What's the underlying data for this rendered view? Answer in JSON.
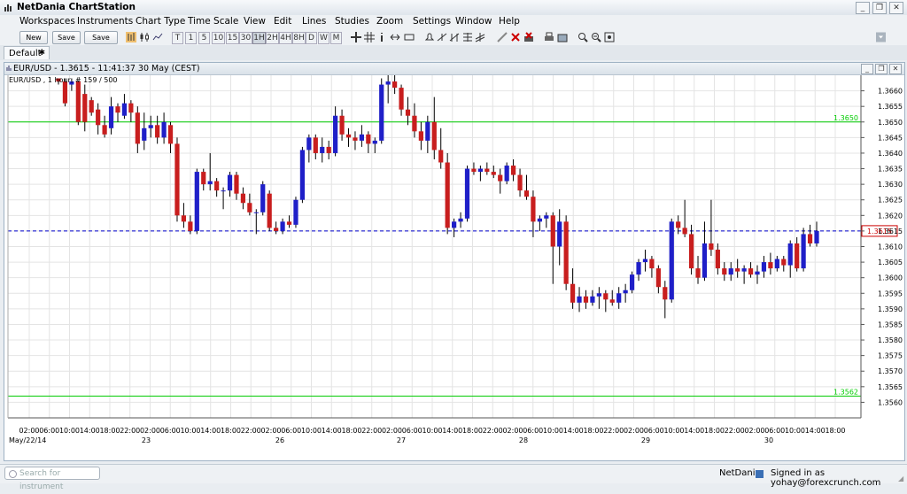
{
  "app": {
    "title": "NetDania ChartStation",
    "win_buttons": [
      "_",
      "❐",
      "✕"
    ]
  },
  "menu": [
    "Workspaces",
    "Instruments",
    "Chart Type",
    "Time Scale",
    "View",
    "Edit",
    "Lines",
    "Studies",
    "Zoom",
    "Settings",
    "Window",
    "Help"
  ],
  "toolbar": {
    "buttons": [
      "New",
      "Save",
      "Save as.."
    ],
    "timescales": [
      "T",
      "1",
      "5",
      "10",
      "15",
      "30",
      "1H",
      "2H",
      "4H",
      "8H",
      "D",
      "W",
      "M"
    ]
  },
  "tab": {
    "label": "Default",
    "pin": "✱"
  },
  "chart_window": {
    "title": "EUR/USD - 1.3615 - 11:41:37  30 May (CEST)",
    "win_buttons": [
      "_",
      "❐",
      "✕"
    ]
  },
  "chart_data": {
    "type": "candlestick",
    "instrument_label": "EUR/USD , 1 hour, # 159 / 500",
    "ylim": [
      1.3555,
      1.3665
    ],
    "y_ticks": [
      1.356,
      1.3565,
      1.357,
      1.3575,
      1.358,
      1.3585,
      1.359,
      1.3595,
      1.36,
      1.3605,
      1.361,
      1.3615,
      1.362,
      1.3625,
      1.363,
      1.3635,
      1.364,
      1.3645,
      1.365,
      1.3655,
      1.366
    ],
    "y_tick_labels": [
      "1.3560",
      "1.3565",
      "1.3570",
      "1.3575",
      "1.3580",
      "1.3585",
      "1.3590",
      "1.3595",
      "1.3600",
      "1.3605",
      "1.3610",
      "1.3615",
      "1.3620",
      "1.3625",
      "1.3630",
      "1.3635",
      "1.3640",
      "1.3645",
      "1.3650",
      "1.3655",
      "1.3660"
    ],
    "x_tick_labels": [
      "02:00",
      "06:00",
      "10:00",
      "14:00",
      "18:00",
      "22:00",
      "02:00",
      "06:00",
      "10:00",
      "14:00",
      "18:00",
      "22:00",
      "02:00",
      "06:00",
      "10:00",
      "14:00",
      "18:00",
      "22:00",
      "02:00",
      "06:00",
      "10:00",
      "14:00",
      "18:00",
      "22:00",
      "02:00",
      "06:00",
      "10:00",
      "14:00",
      "18:00",
      "22:00",
      "02:00",
      "06:00",
      "10:00",
      "14:00",
      "18:00",
      "22:00",
      "02:00",
      "06:00",
      "10:00",
      "14:00",
      "18:00"
    ],
    "date_labels": [
      "May/22/14",
      "23",
      "26",
      "27",
      "28",
      "29",
      "30"
    ],
    "horizontal_lines": [
      {
        "label": "1.3650",
        "value": 1.365,
        "color": "#00cc00"
      },
      {
        "label": "1.3562",
        "value": 1.3562,
        "color": "#00cc00"
      }
    ],
    "current_price": {
      "label": "1.3615",
      "value": 1.3615,
      "color": "#0000cc"
    },
    "colors": {
      "up": "#1f1fc8",
      "down": "#c81e1e",
      "grid": "#e4e4e4"
    },
    "candles": [
      [
        1.3664,
        1.3664,
        1.3662,
        1.3663
      ],
      [
        1.3663,
        1.3664,
        1.3655,
        1.3656
      ],
      [
        1.3662,
        1.3664,
        1.366,
        1.3663
      ],
      [
        1.3663,
        1.3663,
        1.3649,
        1.365
      ],
      [
        1.3659,
        1.3662,
        1.3647,
        1.365
      ],
      [
        1.3657,
        1.3658,
        1.3652,
        1.3653
      ],
      [
        1.3654,
        1.3656,
        1.3646,
        1.3649
      ],
      [
        1.3649,
        1.3652,
        1.3645,
        1.3646
      ],
      [
        1.3648,
        1.3658,
        1.3646,
        1.3655
      ],
      [
        1.3655,
        1.3656,
        1.365,
        1.3653
      ],
      [
        1.3652,
        1.3659,
        1.3651,
        1.3656
      ],
      [
        1.3656,
        1.3657,
        1.365,
        1.3653
      ],
      [
        1.3653,
        1.3655,
        1.364,
        1.3643
      ],
      [
        1.3644,
        1.3653,
        1.3641,
        1.3648
      ],
      [
        1.3648,
        1.3652,
        1.3645,
        1.3649
      ],
      [
        1.3649,
        1.3652,
        1.3643,
        1.3645
      ],
      [
        1.3645,
        1.3653,
        1.3643,
        1.365
      ],
      [
        1.3649,
        1.365,
        1.364,
        1.3643
      ],
      [
        1.3643,
        1.3645,
        1.3618,
        1.362
      ],
      [
        1.362,
        1.3624,
        1.3616,
        1.3618
      ],
      [
        1.3618,
        1.362,
        1.3614,
        1.3615
      ],
      [
        1.3615,
        1.3635,
        1.3614,
        1.3634
      ],
      [
        1.3634,
        1.3635,
        1.3628,
        1.363
      ],
      [
        1.363,
        1.364,
        1.3628,
        1.3631
      ],
      [
        1.3631,
        1.3632,
        1.3626,
        1.3628
      ],
      [
        1.3628,
        1.3629,
        1.3622,
        1.3628
      ],
      [
        1.3628,
        1.3634,
        1.3626,
        1.3633
      ],
      [
        1.3633,
        1.3634,
        1.3625,
        1.3627
      ],
      [
        1.3627,
        1.3629,
        1.3622,
        1.3624
      ],
      [
        1.3624,
        1.3627,
        1.362,
        1.3621
      ],
      [
        1.3621,
        1.3622,
        1.3614,
        1.3621
      ],
      [
        1.3621,
        1.3631,
        1.362,
        1.363
      ],
      [
        1.3627,
        1.3628,
        1.3615,
        1.3616
      ],
      [
        1.3616,
        1.3618,
        1.3614,
        1.3615
      ],
      [
        1.3615,
        1.3619,
        1.3614,
        1.3618
      ],
      [
        1.3618,
        1.362,
        1.3616,
        1.3617
      ],
      [
        1.3617,
        1.3626,
        1.3616,
        1.3625
      ],
      [
        1.3625,
        1.3642,
        1.3624,
        1.3641
      ],
      [
        1.3641,
        1.3646,
        1.3637,
        1.3645
      ],
      [
        1.3645,
        1.3646,
        1.3638,
        1.364
      ],
      [
        1.364,
        1.3645,
        1.3637,
        1.3642
      ],
      [
        1.3642,
        1.3644,
        1.3638,
        1.364
      ],
      [
        1.364,
        1.3655,
        1.3639,
        1.3652
      ],
      [
        1.3652,
        1.3654,
        1.3644,
        1.3646
      ],
      [
        1.3646,
        1.3648,
        1.3642,
        1.3645
      ],
      [
        1.3645,
        1.3647,
        1.3641,
        1.3644
      ],
      [
        1.3644,
        1.3649,
        1.3642,
        1.3646
      ],
      [
        1.3646,
        1.3647,
        1.364,
        1.3643
      ],
      [
        1.3643,
        1.3645,
        1.364,
        1.3644
      ],
      [
        1.3644,
        1.3664,
        1.3643,
        1.3662
      ],
      [
        1.3662,
        1.3665,
        1.3656,
        1.3663
      ],
      [
        1.3663,
        1.3665,
        1.3659,
        1.3661
      ],
      [
        1.3661,
        1.3662,
        1.3652,
        1.3654
      ],
      [
        1.3654,
        1.3658,
        1.3649,
        1.3652
      ],
      [
        1.3652,
        1.3656,
        1.3645,
        1.3647
      ],
      [
        1.3647,
        1.365,
        1.3641,
        1.3644
      ],
      [
        1.3644,
        1.3652,
        1.364,
        1.365
      ],
      [
        1.365,
        1.3658,
        1.3638,
        1.3641
      ],
      [
        1.3641,
        1.3648,
        1.3635,
        1.3637
      ],
      [
        1.3637,
        1.364,
        1.3614,
        1.3616
      ],
      [
        1.3616,
        1.3619,
        1.3613,
        1.3618
      ],
      [
        1.3618,
        1.3621,
        1.3616,
        1.3619
      ],
      [
        1.3619,
        1.3636,
        1.3618,
        1.3635
      ],
      [
        1.3635,
        1.3637,
        1.3633,
        1.3634
      ],
      [
        1.3634,
        1.3636,
        1.3631,
        1.3635
      ],
      [
        1.3635,
        1.3637,
        1.3633,
        1.3634
      ],
      [
        1.3634,
        1.3636,
        1.3632,
        1.3633
      ],
      [
        1.3633,
        1.3635,
        1.3627,
        1.3631
      ],
      [
        1.3631,
        1.3637,
        1.363,
        1.3636
      ],
      [
        1.3636,
        1.3638,
        1.3631,
        1.3633
      ],
      [
        1.3633,
        1.3635,
        1.3626,
        1.3628
      ],
      [
        1.3628,
        1.3633,
        1.3625,
        1.3626
      ],
      [
        1.3626,
        1.3628,
        1.3613,
        1.3618
      ],
      [
        1.3618,
        1.362,
        1.3615,
        1.3619
      ],
      [
        1.3619,
        1.3621,
        1.3616,
        1.362
      ],
      [
        1.362,
        1.3621,
        1.3598,
        1.361
      ],
      [
        1.361,
        1.3622,
        1.3604,
        1.3618
      ],
      [
        1.3618,
        1.362,
        1.3596,
        1.3598
      ],
      [
        1.3598,
        1.3603,
        1.359,
        1.3592
      ],
      [
        1.3592,
        1.3597,
        1.3589,
        1.3594
      ],
      [
        1.3594,
        1.3596,
        1.359,
        1.3592
      ],
      [
        1.3592,
        1.3596,
        1.3591,
        1.3594
      ],
      [
        1.3594,
        1.3597,
        1.359,
        1.3595
      ],
      [
        1.3595,
        1.3596,
        1.3589,
        1.3593
      ],
      [
        1.3593,
        1.3596,
        1.3591,
        1.3592
      ],
      [
        1.3592,
        1.3597,
        1.359,
        1.3595
      ],
      [
        1.3595,
        1.3598,
        1.3592,
        1.3596
      ],
      [
        1.3596,
        1.3602,
        1.3595,
        1.3601
      ],
      [
        1.3601,
        1.3606,
        1.3599,
        1.3605
      ],
      [
        1.3605,
        1.3609,
        1.3602,
        1.3606
      ],
      [
        1.3606,
        1.3607,
        1.36,
        1.3603
      ],
      [
        1.3603,
        1.3604,
        1.3595,
        1.3597
      ],
      [
        1.3597,
        1.3599,
        1.3587,
        1.3593
      ],
      [
        1.3593,
        1.3619,
        1.3592,
        1.3618
      ],
      [
        1.3618,
        1.362,
        1.3614,
        1.3616
      ],
      [
        1.3616,
        1.3625,
        1.3613,
        1.3614
      ],
      [
        1.3614,
        1.3617,
        1.3601,
        1.3603
      ],
      [
        1.3603,
        1.3607,
        1.3598,
        1.36
      ],
      [
        1.36,
        1.3618,
        1.3599,
        1.3611
      ],
      [
        1.3611,
        1.3625,
        1.3607,
        1.3609
      ],
      [
        1.3609,
        1.3611,
        1.3601,
        1.3603
      ],
      [
        1.3603,
        1.3605,
        1.3599,
        1.3601
      ],
      [
        1.3601,
        1.3605,
        1.3599,
        1.3603
      ],
      [
        1.3603,
        1.3606,
        1.36,
        1.3602
      ],
      [
        1.3602,
        1.3604,
        1.3598,
        1.3603
      ],
      [
        1.3603,
        1.3605,
        1.36,
        1.3601
      ],
      [
        1.3601,
        1.3604,
        1.3598,
        1.3602
      ],
      [
        1.3602,
        1.3607,
        1.36,
        1.3605
      ],
      [
        1.3605,
        1.3608,
        1.3601,
        1.3603
      ],
      [
        1.3603,
        1.3607,
        1.3602,
        1.3606
      ],
      [
        1.3606,
        1.3607,
        1.3602,
        1.3604
      ],
      [
        1.3604,
        1.3612,
        1.36,
        1.3611
      ],
      [
        1.3611,
        1.3613,
        1.3602,
        1.3603
      ],
      [
        1.3603,
        1.3616,
        1.3602,
        1.3614
      ],
      [
        1.3614,
        1.3617,
        1.361,
        1.3611
      ],
      [
        1.3611,
        1.3618,
        1.361,
        1.3615
      ]
    ]
  },
  "statusbar": {
    "search_placeholder": "Search for instrument",
    "brand": "NetDania",
    "signed_in": "Signed in as yohay@forexcrunch.com"
  }
}
